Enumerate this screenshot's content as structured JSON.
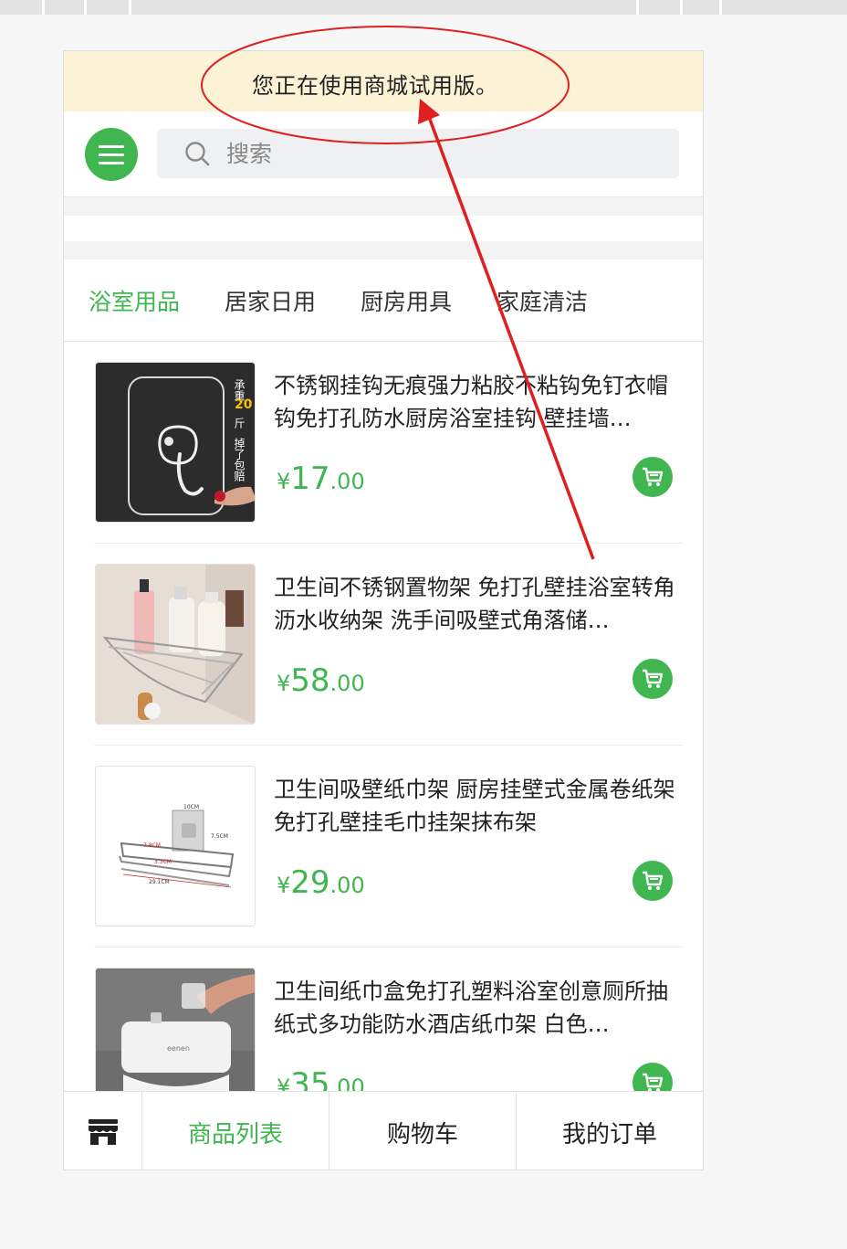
{
  "trial_notice": "您正在使用商城试用版。",
  "search": {
    "placeholder": "搜索",
    "value": ""
  },
  "tabs": [
    {
      "label": "浴室用品",
      "active": true
    },
    {
      "label": "居家日用",
      "active": false
    },
    {
      "label": "厨房用具",
      "active": false
    },
    {
      "label": "家庭清洁",
      "active": false
    }
  ],
  "products": [
    {
      "title": "不锈钢挂钩无痕强力粘胶不粘钩免钉衣帽钩免打孔防水厨房浴室挂钩 壁挂墙…",
      "currency": "¥",
      "price_int": "17",
      "price_dec": ".00",
      "image": "adhesive-hook-photo",
      "image_text": {
        "line1": "承重",
        "num": "20",
        "line2": "斤",
        "line3": "掉了包赔"
      }
    },
    {
      "title": "卫生间不锈钢置物架 免打孔壁挂浴室转角沥水收纳架 洗手间吸壁式角落储…",
      "currency": "¥",
      "price_int": "58",
      "price_dec": ".00",
      "image": "corner-shelf-photo"
    },
    {
      "title": "卫生间吸壁纸巾架 厨房挂壁式金属卷纸架 免打孔壁挂毛巾挂架抹布架",
      "currency": "¥",
      "price_int": "29",
      "price_dec": ".00",
      "image": "paper-holder-photo",
      "image_text": {
        "dim_top": "10CM",
        "dim_side": "7.5CM",
        "dim_a": "7.8CM",
        "dim_b": "3.3CM",
        "dim_bottom": "29.1CM"
      }
    },
    {
      "title": "卫生间纸巾盒免打孔塑料浴室创意厕所抽纸式多功能防水酒店纸巾架 白色…",
      "currency": "¥",
      "price_int": "35",
      "price_dec": ".00",
      "image": "tissue-box-photo",
      "image_text": {
        "brand": "eenen"
      }
    }
  ],
  "bottom_nav": {
    "home_icon": "store-icon",
    "items": [
      {
        "label": "商品列表",
        "active": true
      },
      {
        "label": "购物车",
        "active": false
      },
      {
        "label": "我的订单",
        "active": false
      }
    ]
  },
  "colors": {
    "accent": "#3fb64f",
    "banner": "#fcf3d6",
    "annotation": "#e02020"
  }
}
